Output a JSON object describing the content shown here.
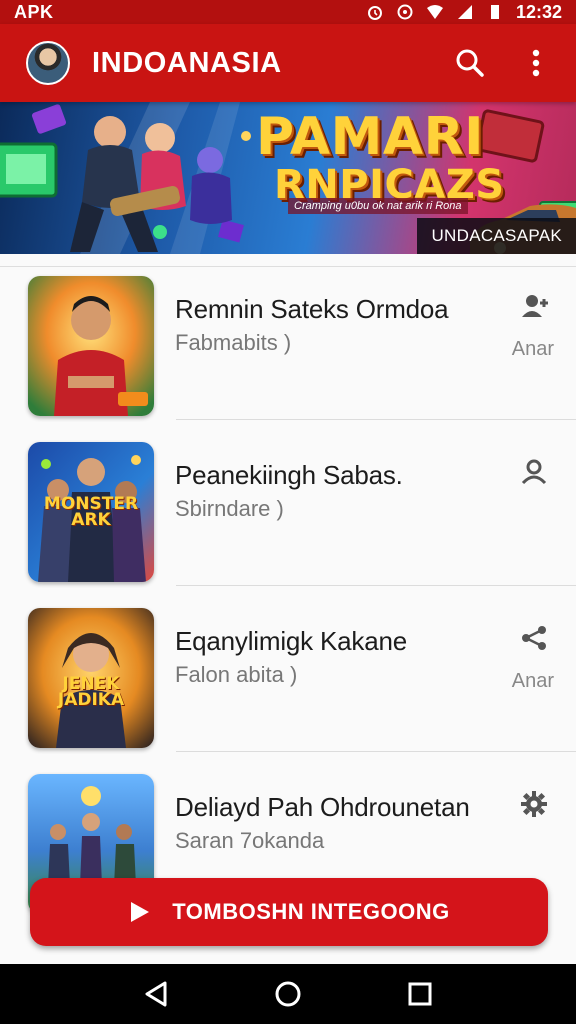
{
  "status_bar": {
    "left_label": "APK",
    "time": "12:32"
  },
  "app_bar": {
    "title": "INDOANASIA"
  },
  "banner": {
    "title_line1": "PAMARI",
    "title_line2": "RNPICAZS",
    "subline": "Cramping u0bu ok nat arik ri Rona",
    "badge": "UNDACASAPAK"
  },
  "items": [
    {
      "title": "Remnin Sateks Ormdoa",
      "subtitle": "Fabmabits )",
      "meta": "Anar",
      "action_icon": "user-add-icon"
    },
    {
      "title": "Peanekiingh Sabas.",
      "subtitle": "Sbirndare )",
      "meta": "",
      "action_icon": "user-icon",
      "thumb_text": "MONSTER ARK"
    },
    {
      "title": "Eqanylimigk Kakane",
      "subtitle": "Falon abita )",
      "meta": "Anar",
      "action_icon": "share-icon",
      "thumb_text": "JENEK JADIKA"
    },
    {
      "title": "Deliayd Pah Ohdrounetan",
      "subtitle": "Saran 7okanda",
      "meta": "",
      "action_icon": "gear-icon"
    }
  ],
  "cta": {
    "label": "TOMBOSHN INTEGOONG"
  },
  "colors": {
    "primary": "#c91412",
    "status": "#b3100f",
    "cta": "#d4141a"
  }
}
